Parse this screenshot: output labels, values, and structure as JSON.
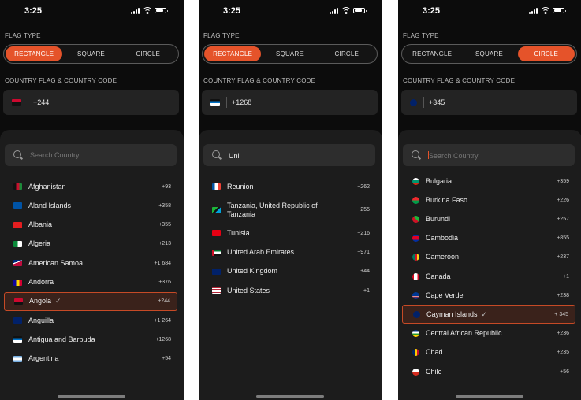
{
  "status_time": "3:25",
  "section_flag_type": "FLAG TYPE",
  "section_country": "COUNTRY FLAG & COUNTRY CODE",
  "flag_type_options": [
    "RECTANGLE",
    "SQUARE",
    "CIRCLE"
  ],
  "accent_color": "#e5532a",
  "screens": [
    {
      "active_flag_type": "RECTANGLE",
      "selected_code": "+244",
      "selected_flag_icon": "angola-flag-icon",
      "search_value": "",
      "search_placeholder": "Search Country",
      "rows": [
        {
          "name": "Afghanistan",
          "code": "+93",
          "flag": "afghanistan-flag-icon",
          "selected": false
        },
        {
          "name": "Aland Islands",
          "code": "+358",
          "flag": "aland-islands-flag-icon",
          "selected": false
        },
        {
          "name": "Albania",
          "code": "+355",
          "flag": "albania-flag-icon",
          "selected": false
        },
        {
          "name": "Algeria",
          "code": "+213",
          "flag": "algeria-flag-icon",
          "selected": false
        },
        {
          "name": "American Samoa",
          "code": "+1 684",
          "flag": "american-samoa-flag-icon",
          "selected": false
        },
        {
          "name": "Andorra",
          "code": "+376",
          "flag": "andorra-flag-icon",
          "selected": false
        },
        {
          "name": "Angola",
          "code": "+244",
          "flag": "angola-flag-icon",
          "selected": true
        },
        {
          "name": "Anguilla",
          "code": "+1 264",
          "flag": "anguilla-flag-icon",
          "selected": false
        },
        {
          "name": "Antigua and Barbuda",
          "code": "+1268",
          "flag": "antigua-flag-icon",
          "selected": false
        },
        {
          "name": "Argentina",
          "code": "+54",
          "flag": "argentina-flag-icon",
          "selected": false
        }
      ]
    },
    {
      "active_flag_type": "RECTANGLE",
      "selected_code": "+1268",
      "selected_flag_icon": "antigua-flag-icon",
      "search_value": "Uni",
      "search_placeholder": "Search Country",
      "rows": [
        {
          "name": "Reunion",
          "code": "+262",
          "flag": "reunion-flag-icon",
          "selected": false
        },
        {
          "name": "Tanzania, United Republic of Tanzania",
          "code": "+255",
          "flag": "tanzania-flag-icon",
          "selected": false
        },
        {
          "name": "Tunisia",
          "code": "+216",
          "flag": "tunisia-flag-icon",
          "selected": false
        },
        {
          "name": "United Arab Emirates",
          "code": "+971",
          "flag": "uae-flag-icon",
          "selected": false
        },
        {
          "name": "United Kingdom",
          "code": "+44",
          "flag": "uk-flag-icon",
          "selected": false
        },
        {
          "name": "United States",
          "code": "+1",
          "flag": "us-flag-icon",
          "selected": false
        }
      ]
    },
    {
      "active_flag_type": "CIRCLE",
      "selected_code": "+345",
      "selected_flag_icon": "cayman-islands-flag-icon",
      "search_value": "",
      "search_placeholder": "Search Country",
      "rows": [
        {
          "name": "Bulgaria",
          "code": "+359",
          "flag": "bulgaria-flag-icon",
          "selected": false
        },
        {
          "name": "Burkina Faso",
          "code": "+226",
          "flag": "burkina-faso-flag-icon",
          "selected": false
        },
        {
          "name": "Burundi",
          "code": "+257",
          "flag": "burundi-flag-icon",
          "selected": false
        },
        {
          "name": "Cambodia",
          "code": "+855",
          "flag": "cambodia-flag-icon",
          "selected": false
        },
        {
          "name": "Cameroon",
          "code": "+237",
          "flag": "cameroon-flag-icon",
          "selected": false
        },
        {
          "name": "Canada",
          "code": "+1",
          "flag": "canada-flag-icon",
          "selected": false
        },
        {
          "name": "Cape Verde",
          "code": "+238",
          "flag": "cape-verde-flag-icon",
          "selected": false
        },
        {
          "name": "Cayman Islands",
          "code": "+ 345",
          "flag": "cayman-islands-flag-icon",
          "selected": true
        },
        {
          "name": "Central African Republic",
          "code": "+236",
          "flag": "car-flag-icon",
          "selected": false
        },
        {
          "name": "Chad",
          "code": "+235",
          "flag": "chad-flag-icon",
          "selected": false
        },
        {
          "name": "Chile",
          "code": "+56",
          "flag": "chile-flag-icon",
          "selected": false
        }
      ]
    }
  ]
}
